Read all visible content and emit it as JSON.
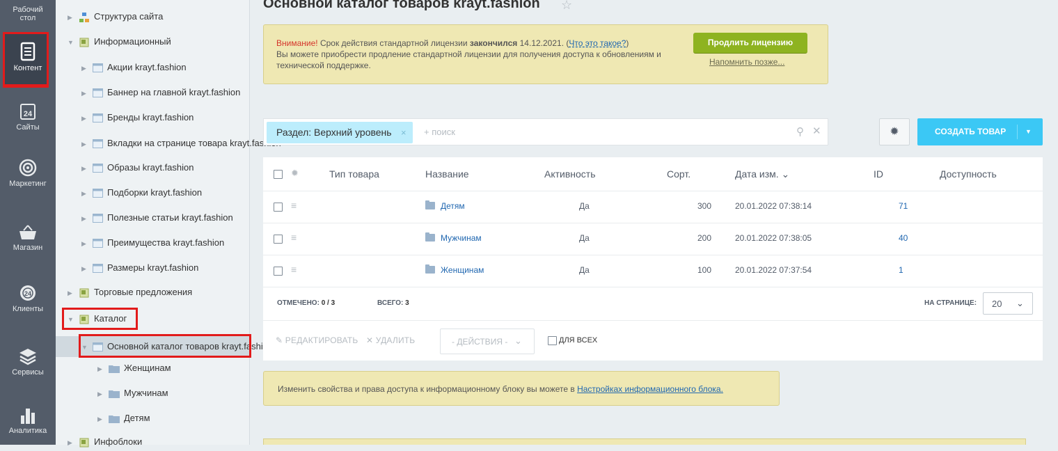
{
  "rail": {
    "items": [
      {
        "label": "Рабочий стол"
      },
      {
        "label": "Контент"
      },
      {
        "label": "Сайты"
      },
      {
        "label": "Маркетинг"
      },
      {
        "label": "Магазин"
      },
      {
        "label": "Клиенты"
      },
      {
        "label": "Сервисы"
      },
      {
        "label": "Аналитика"
      }
    ],
    "rail_color": "#535c69"
  },
  "tree": {
    "items": [
      {
        "label": "Структура сайта"
      },
      {
        "label": "Информационный"
      },
      {
        "label": "Акции krayt.fashion"
      },
      {
        "label": "Баннер на главной krayt.fashion"
      },
      {
        "label": "Бренды krayt.fashion"
      },
      {
        "label": "Вкладки на странице товара krayt.fashion"
      },
      {
        "label": "Образы krayt.fashion"
      },
      {
        "label": "Подборки krayt.fashion"
      },
      {
        "label": "Полезные статьи krayt.fashion"
      },
      {
        "label": "Преимущества krayt.fashion"
      },
      {
        "label": "Размеры krayt.fashion"
      },
      {
        "label": "Торговые предложения"
      },
      {
        "label": "Каталог"
      },
      {
        "label": "Основной каталог товаров krayt.fashion"
      },
      {
        "label": "Женщинам"
      },
      {
        "label": "Мужчинам"
      },
      {
        "label": "Детям"
      },
      {
        "label": "Инфоблоки"
      }
    ]
  },
  "page": {
    "title": "Основной каталог товаров krayt.fashion",
    "star": "☆"
  },
  "notice": {
    "warn": "Внимание!",
    "text1": " Срок действия стандартной лицензии ",
    "bold": "закончился",
    "text2": " 14.12.2021. (",
    "link": "Что это такое?",
    "text3": ")",
    "line2": "Вы можете приобрести продление стандартной лицензии для получения доступа к обновлениям и технической поддержке.",
    "renew_button": "Продлить лицензию",
    "remind_link": "Напомнить позже..."
  },
  "filter": {
    "chip": "Раздел: Верхний уровень",
    "chip_close": "×",
    "placeholder": "+ поиск",
    "search_icon": "⚲",
    "clear_icon": "✕"
  },
  "toolbar": {
    "settings_icon": "✹",
    "create_label": "СОЗДАТЬ ТОВАР",
    "create_arrow": "▼"
  },
  "grid": {
    "columns": [
      "Тип товара",
      "Название",
      "Активность",
      "Сорт.",
      "Дата изм. ⌄",
      "ID",
      "Доступность"
    ],
    "rows": [
      {
        "type": "",
        "name": "Детям",
        "active": "Да",
        "sort": "300",
        "date": "20.01.2022 07:38:14",
        "id": "71",
        "avail": ""
      },
      {
        "type": "",
        "name": "Мужчинам",
        "active": "Да",
        "sort": "200",
        "date": "20.01.2022 07:38:05",
        "id": "40",
        "avail": ""
      },
      {
        "type": "",
        "name": "Женщинам",
        "active": "Да",
        "sort": "100",
        "date": "20.01.2022 07:37:54",
        "id": "1",
        "avail": ""
      }
    ],
    "selected_label": "ОТМЕЧЕНО:",
    "selected_value": "0 / 3",
    "total_label": "ВСЕГО:",
    "total_value": "3",
    "perpage_label": "НА СТРАНИЦЕ:",
    "perpage_value": "20",
    "perpage_arrow": "⌄",
    "edit_label": "✎ РЕДАКТИРОВАТЬ",
    "delete_label": "✕ УДАЛИТЬ",
    "actions_value": "- ДЕЙСТВИЯ -",
    "actions_arrow": "⌄",
    "forall_label": "ДЛЯ ВСЕХ"
  },
  "iblock_note": {
    "text": "Изменить свойства и права доступа к информационному блоку вы можете в ",
    "link": "Настройках информационного блока."
  },
  "colors": {
    "accent": "#3bc8f5",
    "renew": "#8eb320",
    "link": "#2067b0",
    "highlight_red": "#e21b1b"
  }
}
